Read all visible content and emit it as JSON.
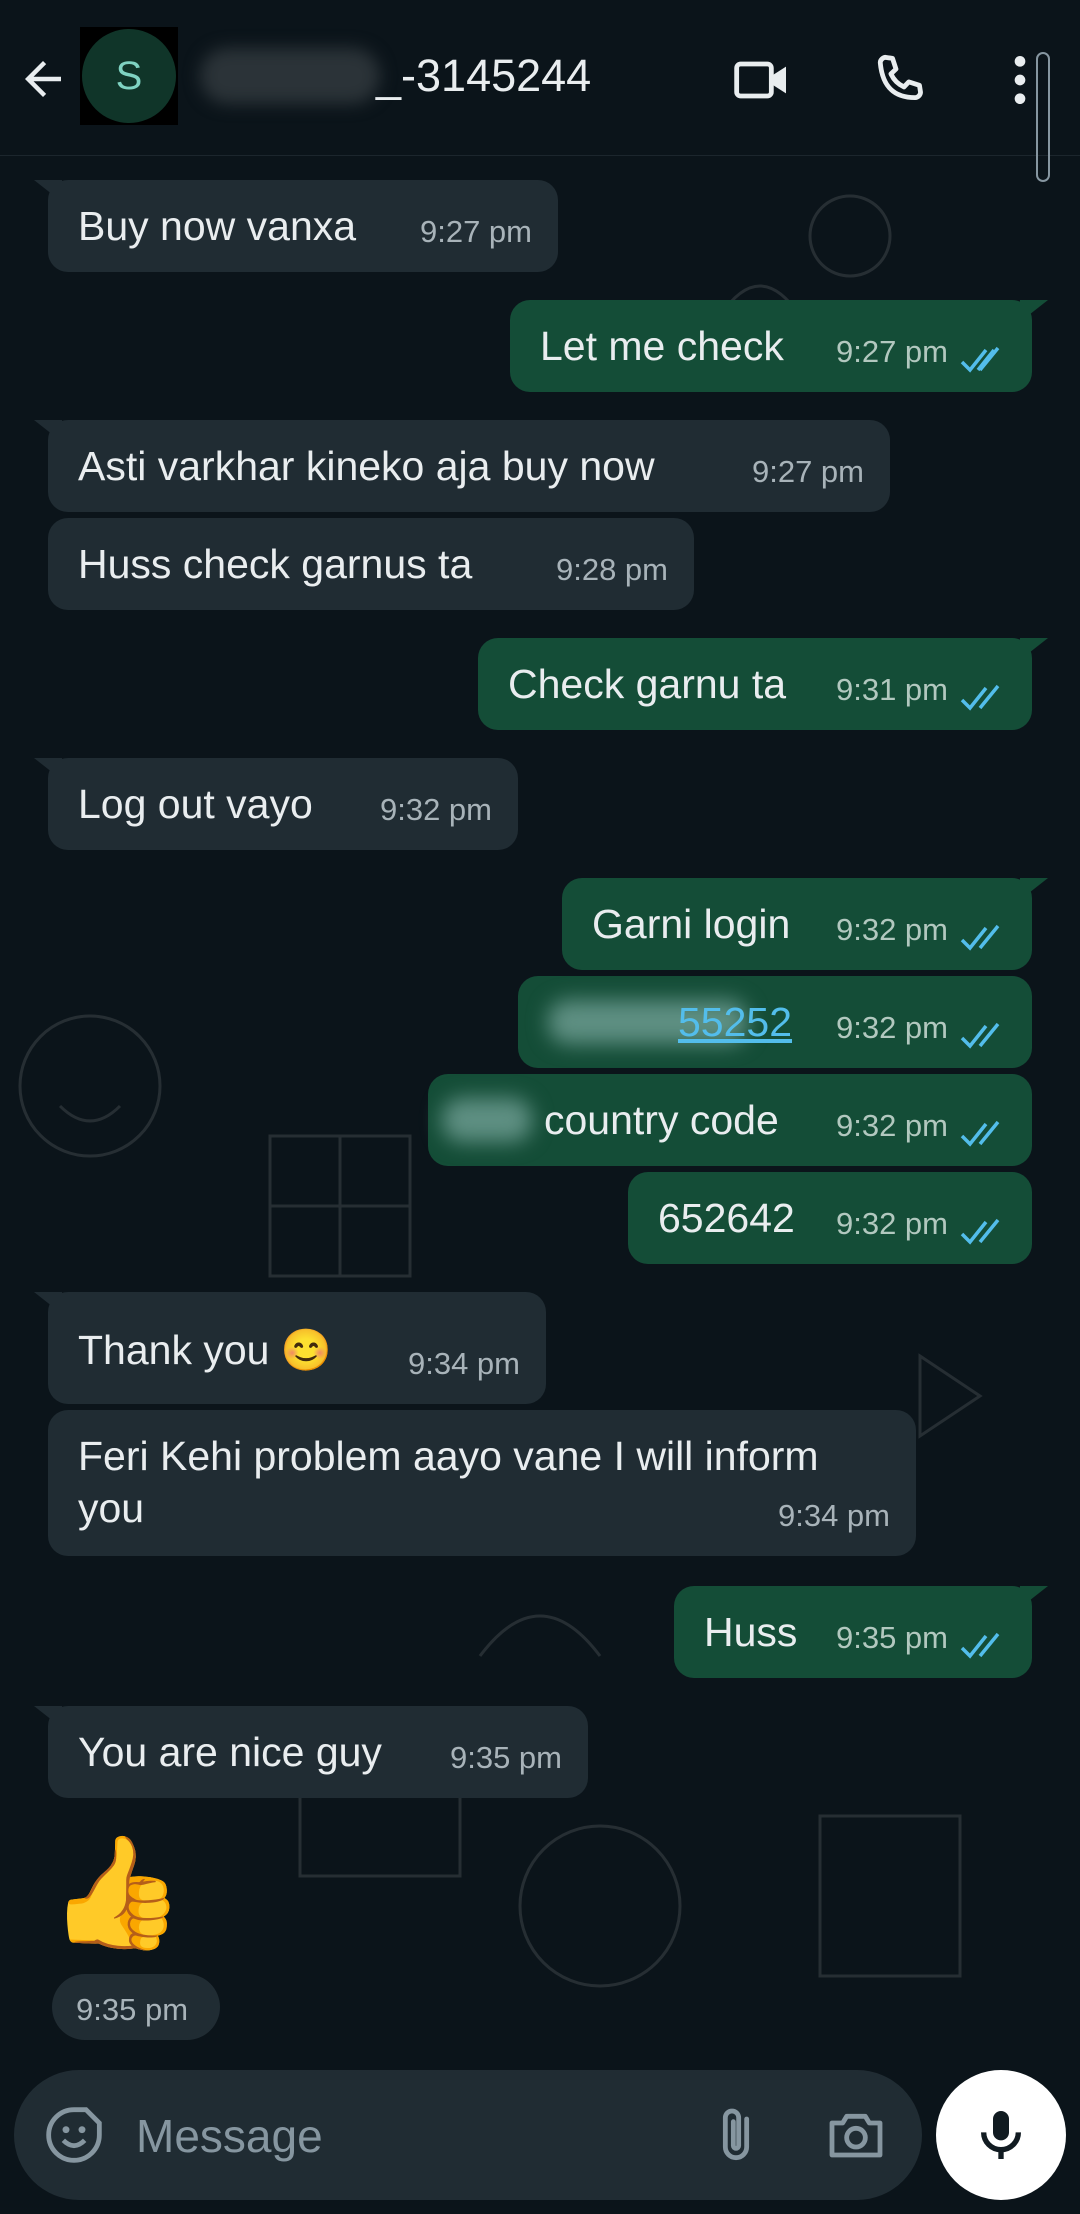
{
  "header": {
    "avatar_initial": "S",
    "contact_name": "_-3145244"
  },
  "messages": [
    {
      "dir": "in",
      "text": "Buy now vanxa",
      "time": "9:27 pm"
    },
    {
      "dir": "out",
      "text": "Let me check",
      "time": "9:27 pm"
    },
    {
      "dir": "in",
      "text": "Asti varkhar kineko aja buy now",
      "time": "9:27 pm"
    },
    {
      "dir": "in",
      "text": "Huss check garnus ta",
      "time": "9:28 pm"
    },
    {
      "dir": "out",
      "text": "Check garnu ta",
      "time": "9:31 pm"
    },
    {
      "dir": "in",
      "text": "Log out vayo",
      "time": "9:32 pm"
    },
    {
      "dir": "out",
      "text": "Garni login",
      "time": "9:32 pm"
    },
    {
      "dir": "out",
      "text": "55252",
      "time": "9:32 pm"
    },
    {
      "dir": "out",
      "text": "country code",
      "time": "9:32 pm"
    },
    {
      "dir": "out",
      "text": "652642",
      "time": "9:32 pm"
    },
    {
      "dir": "in",
      "text": "Thank you 😊",
      "time": "9:34 pm"
    },
    {
      "dir": "in",
      "text_line1": "Feri Kehi problem aayo vane I will inform",
      "text_line2": "you",
      "time": "9:34 pm"
    },
    {
      "dir": "out",
      "text": "Huss",
      "time": "9:35 pm"
    },
    {
      "dir": "in",
      "text": "You are nice guy",
      "time": "9:35 pm"
    },
    {
      "dir": "in",
      "emoji": "👍",
      "time": "9:35 pm"
    }
  ],
  "composer": {
    "placeholder": "Message"
  },
  "icons": [
    "back-arrow-icon",
    "video-call-icon",
    "phone-icon",
    "more-options-icon",
    "emoji-icon",
    "attach-icon",
    "camera-icon",
    "mic-icon",
    "double-check-icon"
  ],
  "colors": {
    "background": "#0b141a",
    "incoming_bubble": "#202c33",
    "outgoing_bubble": "#144d37",
    "read_ticks": "#53bdeb"
  }
}
